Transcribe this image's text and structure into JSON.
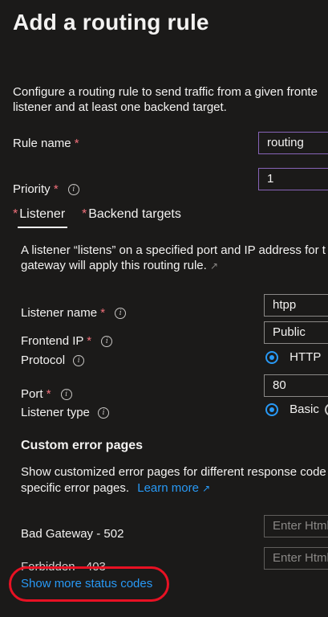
{
  "header": {
    "title": "Add a routing rule"
  },
  "intro": {
    "line1": "Configure a routing rule to send traffic from a given fronte",
    "line2": "listener and at least one backend target."
  },
  "rule_name": {
    "label": "Rule name",
    "value": "routing"
  },
  "priority": {
    "label": "Priority",
    "value": "1"
  },
  "tabs": [
    {
      "label": "Listener",
      "required": "*"
    },
    {
      "label": "Backend targets",
      "required": "*"
    }
  ],
  "listener_desc": {
    "line1": "A listener “listens” on a specified port and IP address for t",
    "line2": "gateway will apply this routing rule."
  },
  "listener_name": {
    "label": "Listener name",
    "value": "htpp"
  },
  "frontend_ip": {
    "label": "Frontend IP",
    "value": "Public"
  },
  "protocol": {
    "label": "Protocol",
    "options": [
      "HTTP"
    ]
  },
  "port": {
    "label": "Port",
    "value": "80"
  },
  "listener_type": {
    "label": "Listener type",
    "options": [
      "Basic"
    ]
  },
  "custom_errors": {
    "heading": "Custom error pages",
    "desc_line1": "Show customized error pages for different response code",
    "desc_line2": "specific error pages.",
    "learn_more": "Learn more"
  },
  "bad_gateway": {
    "label": "Bad Gateway - 502",
    "placeholder": "Enter Html"
  },
  "forbidden": {
    "label": "Forbidden - 403",
    "placeholder": "Enter Html"
  },
  "show_more": "Show more status codes",
  "colors": {
    "accent": "#2899f5",
    "required": "#f1707b",
    "highlight": "#e81123",
    "focus": "#8764b8"
  }
}
